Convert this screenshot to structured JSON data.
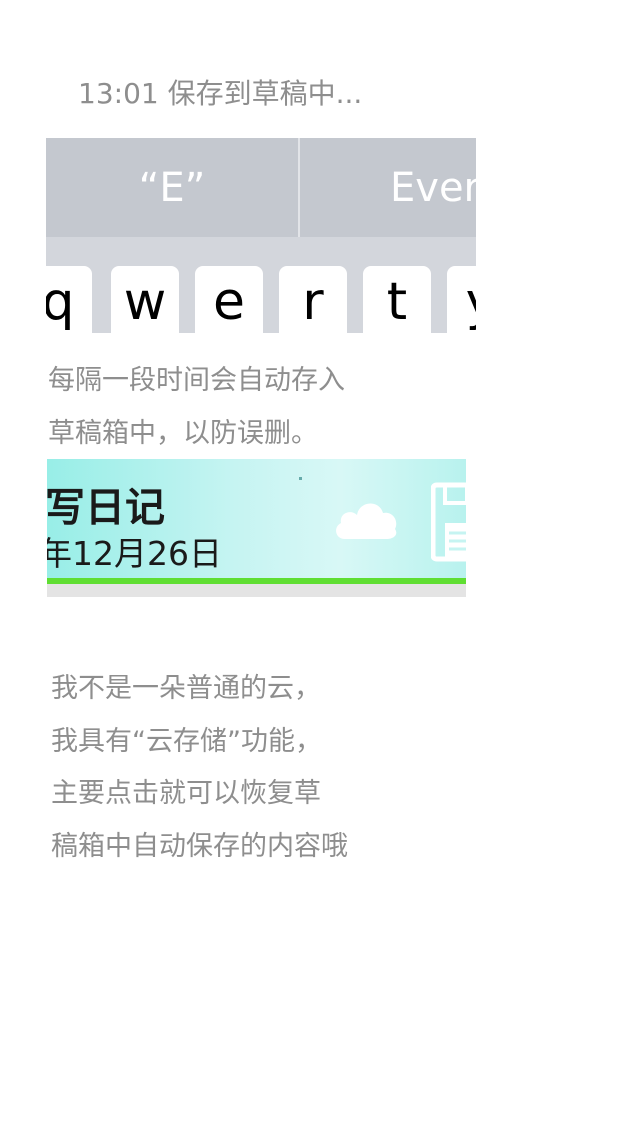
{
  "status": {
    "text": "13:01 保存到草稿中..."
  },
  "keyboard": {
    "suggestions": [
      "“E”",
      "Ever"
    ],
    "keys": [
      "q",
      "w",
      "e",
      "r",
      "t",
      "y"
    ]
  },
  "info": {
    "lines": [
      "每隔一段时间会自动存入",
      "草稿箱中，以防误删。"
    ]
  },
  "banner": {
    "title": "写日记",
    "date": "年12月26日",
    "icons": [
      "cloud-icon",
      "floppy-disk-icon"
    ]
  },
  "description": {
    "lines": [
      "我不是一朵普通的云，",
      "我具有“云存储”功能，",
      "主要点击就可以恢复草",
      "稿箱中自动保存的内容哦"
    ]
  }
}
